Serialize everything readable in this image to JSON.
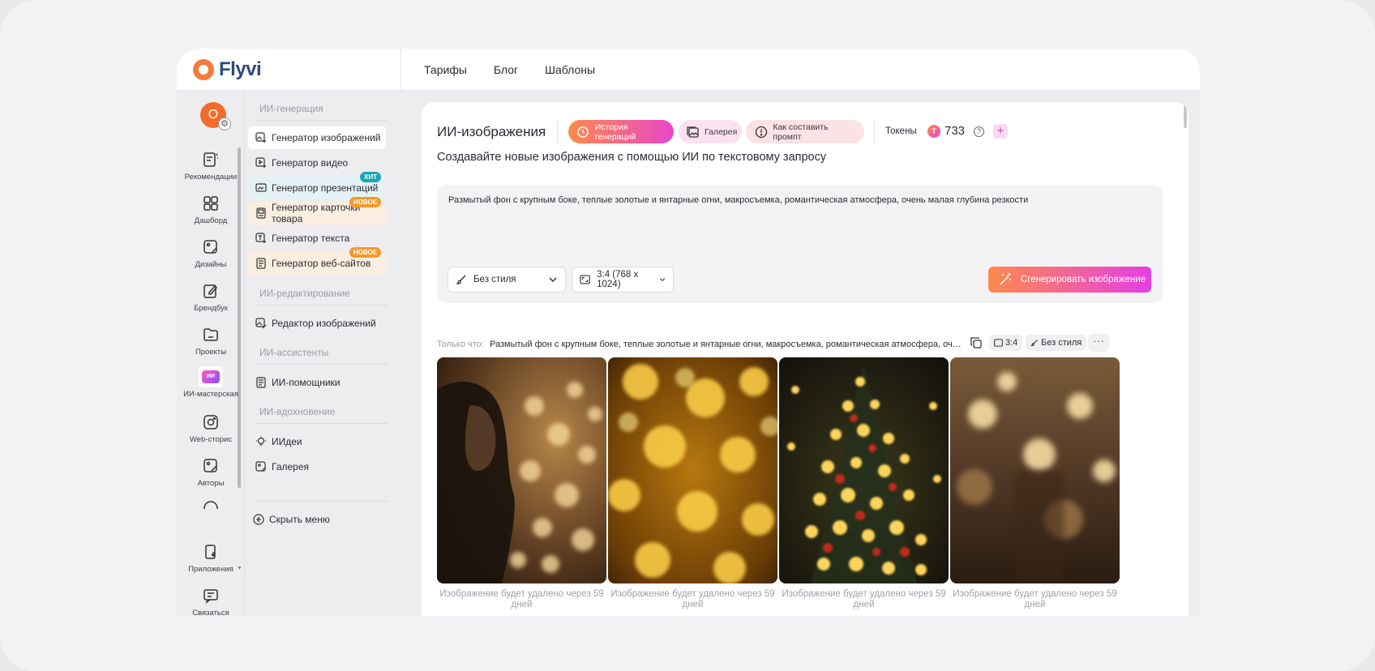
{
  "brand": {
    "name": "Flyvi"
  },
  "topnav": [
    "Тарифы",
    "Блог",
    "Шаблоны"
  ],
  "rail": {
    "avatar_letter": "O",
    "items": [
      {
        "label": "Рекомендации",
        "icon": "recommendations-icon"
      },
      {
        "label": "Дашборд",
        "icon": "dashboard-icon"
      },
      {
        "label": "Дизайны",
        "icon": "designs-icon"
      },
      {
        "label": "Брендбук",
        "icon": "brandbook-icon"
      },
      {
        "label": "Проекты",
        "icon": "folder-icon"
      },
      {
        "label": "ИИ-мастерская",
        "icon": "ai-workshop-icon",
        "badge": "ИИ"
      },
      {
        "label": "Web-сторис",
        "icon": "web-stories-icon"
      },
      {
        "label": "Авторы",
        "icon": "authors-icon"
      },
      {
        "label": "Приложения",
        "icon": "apps-icon"
      },
      {
        "label": "Связаться",
        "icon": "contact-icon"
      }
    ]
  },
  "menu": {
    "sections": {
      "generation": "ИИ-генерация",
      "editing": "ИИ-редактирование",
      "assistants": "ИИ-ассистенты",
      "inspiration": "ИИ-вдохновение"
    },
    "items": {
      "image_gen": "Генератор изображений",
      "video_gen": "Генератор видео",
      "presentation_gen": "Генератор презентаций",
      "product_card_gen": "Генератор карточки товара",
      "text_gen": "Генератор текста",
      "website_gen": "Генератор веб-сайтов",
      "image_editor": "Редактор изображений",
      "ai_helpers": "ИИ-помощники",
      "ideas": "ИИдеи",
      "gallery": "Галерея"
    },
    "badges": {
      "hit": "ХИТ",
      "new": "НОВОЕ"
    },
    "hide_menu": "Скрыть меню"
  },
  "main": {
    "title": "ИИ-изображения",
    "pills": {
      "history": "История генераций",
      "gallery": "Галерея",
      "howto": "Как составить промпт"
    },
    "tokens_label": "Токены",
    "token_symbol": "T",
    "tokens": "733",
    "help": "?",
    "plus": "+",
    "subtitle": "Создавайте новые изображения с помощью ИИ по текстовому запросу",
    "prompt": "Размытый фон с крупным боке, теплые золотые и янтарные огни, макросъемка, романтическая атмосфера, очень малая глубина резкости",
    "style_select": "Без стиля",
    "ratio_select": "3:4 (768 x 1024)",
    "generate_button": "Сгенерировать изображение",
    "recent": {
      "label": "Только что:",
      "prompt": "Размытый фон с крупным боке, теплые золотые и янтарные огни, макросъемка, романтическая атмосфера, очень малая глубина резкости",
      "ratio_chip": "3:4",
      "style_chip": "Без стиля",
      "more": "···"
    },
    "thumbnails": [
      {
        "caption": "Изображение будет удалено через 59 дней",
        "scene": "portrait-bokeh"
      },
      {
        "caption": "Изображение будет удалено через 59 дней",
        "scene": "golden-bokeh"
      },
      {
        "caption": "Изображение будет удалено через 59 дней",
        "scene": "tree-lights"
      },
      {
        "caption": "Изображение будет удалено через 59 дней",
        "scene": "soft-bokeh"
      }
    ]
  },
  "colors": {
    "accent_orange": "#f47b3b",
    "accent_pink": "#e847c8",
    "logo_text": "#2d4a7a"
  }
}
